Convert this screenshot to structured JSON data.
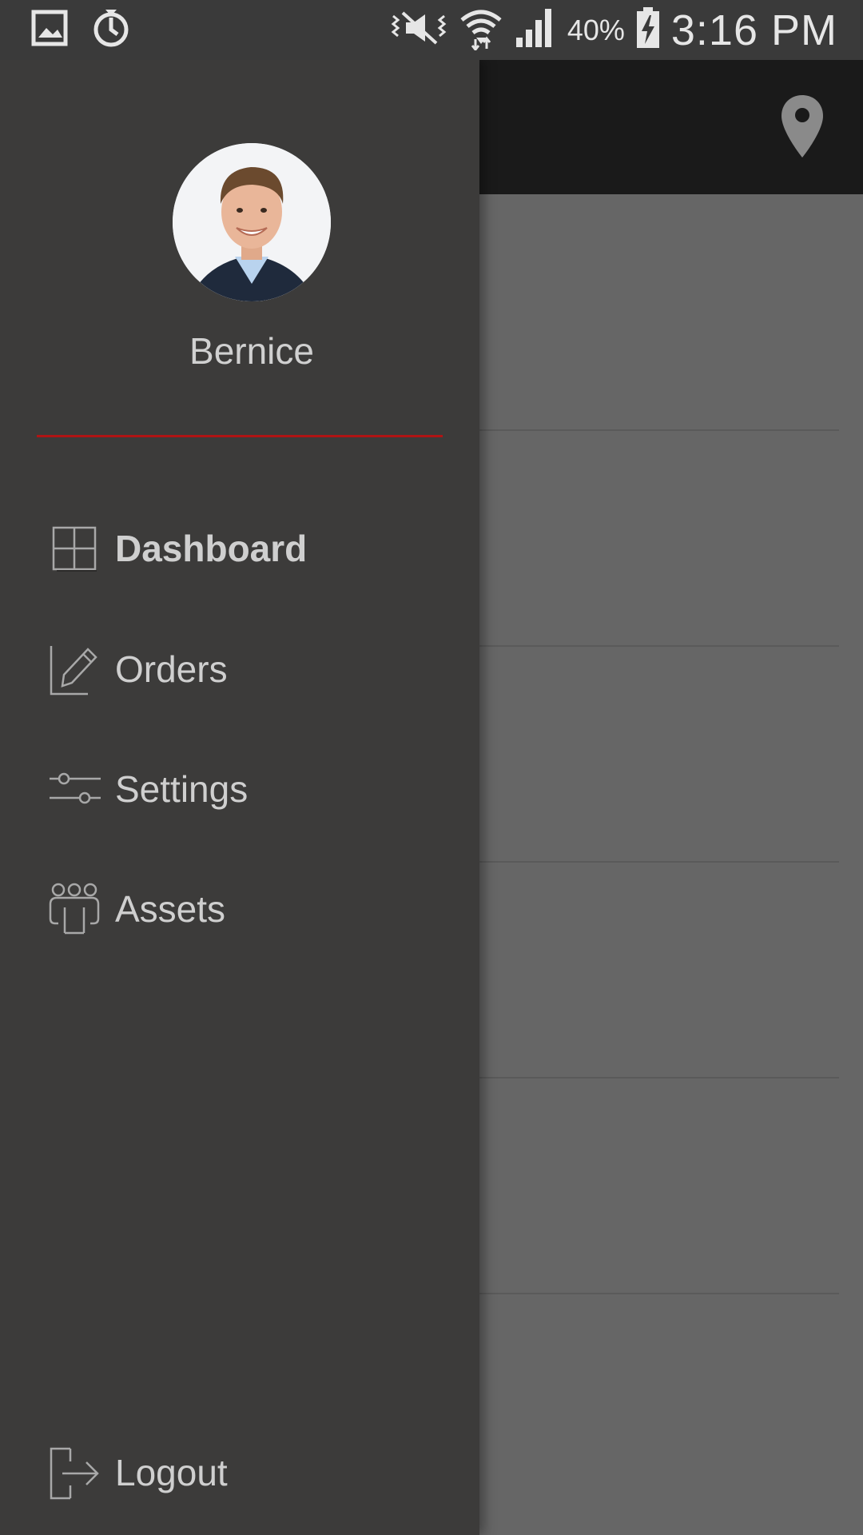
{
  "status_bar": {
    "battery_percent": "40%",
    "time": "3:16 PM"
  },
  "drawer": {
    "user": {
      "name": "Bernice"
    },
    "accent_color": "#b01414",
    "nav_items": [
      {
        "label": "Dashboard",
        "icon": "dashboard-grid-icon",
        "active": true
      },
      {
        "label": "Orders",
        "icon": "edit-pencil-icon",
        "active": false
      },
      {
        "label": "Settings",
        "icon": "sliders-icon",
        "active": false
      },
      {
        "label": "Assets",
        "icon": "people-group-icon",
        "active": false
      }
    ],
    "logout_label": "Logout"
  },
  "toolbar": {
    "action_icon": "location-pin-icon"
  }
}
